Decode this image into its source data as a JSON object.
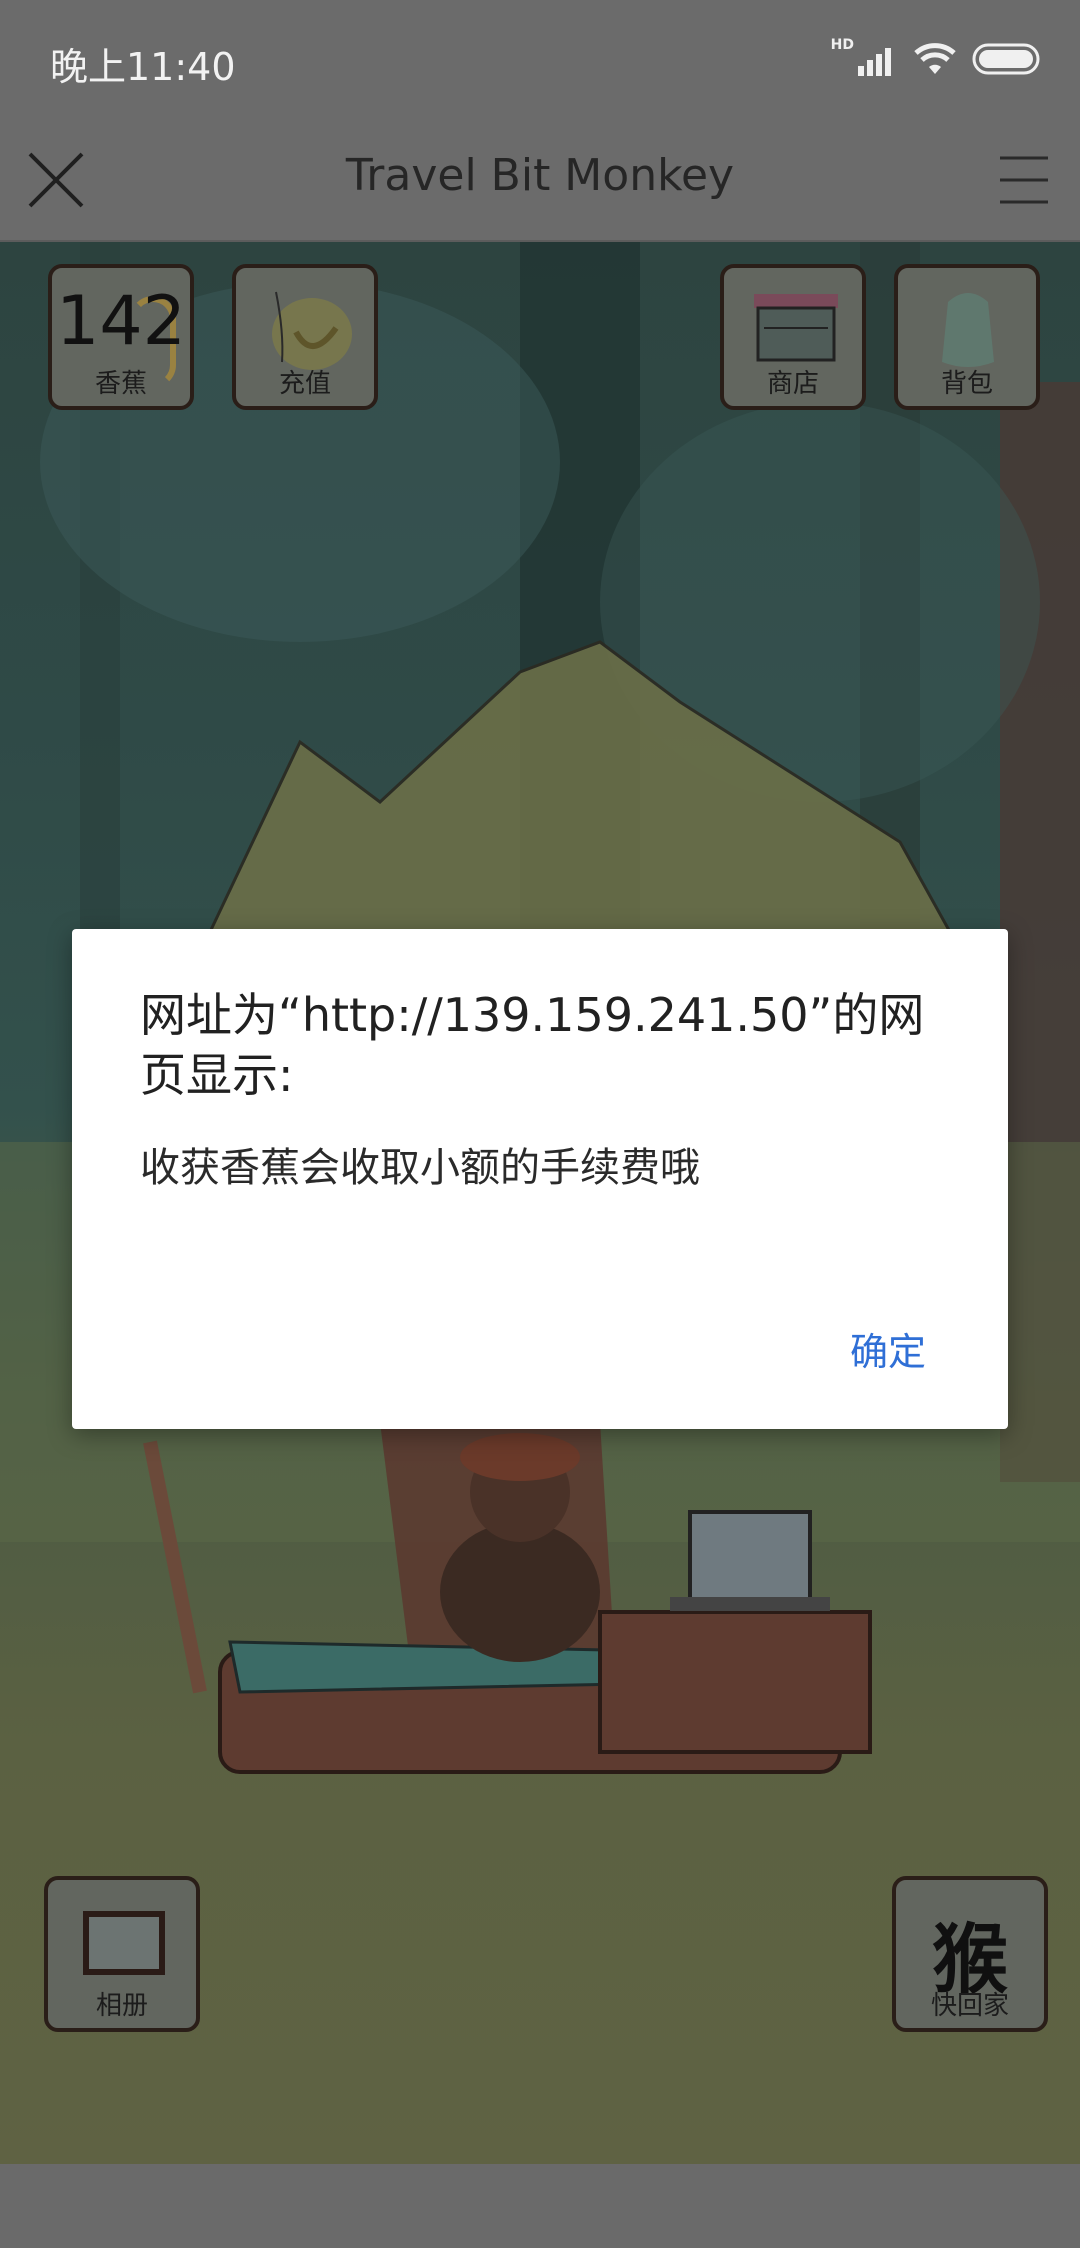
{
  "status_bar": {
    "time": "晚上11:40",
    "network_badge": "HD",
    "icons": [
      "signal-icon",
      "wifi-icon",
      "battery-icon"
    ]
  },
  "title_bar": {
    "title": "Travel Bit Monkey",
    "close_icon": "close-icon",
    "menu_icon": "menu-icon"
  },
  "hud": {
    "banana": {
      "count": "142",
      "label": "香蕉"
    },
    "recharge": {
      "label": "充值"
    },
    "shop": {
      "label": "商店"
    },
    "backpack": {
      "label": "背包"
    },
    "album": {
      "label": "相册"
    },
    "go_home": {
      "glyph": "猴",
      "label": "快回家"
    }
  },
  "dialog": {
    "title": "网址为“http://139.159.241.50”的网页显示:",
    "message": "收获香蕉会收取小额的手续费哦",
    "ok_label": "确定"
  },
  "colors": {
    "dialog_button": "#2f6fd6",
    "bar_background": "#6b6b6b"
  }
}
